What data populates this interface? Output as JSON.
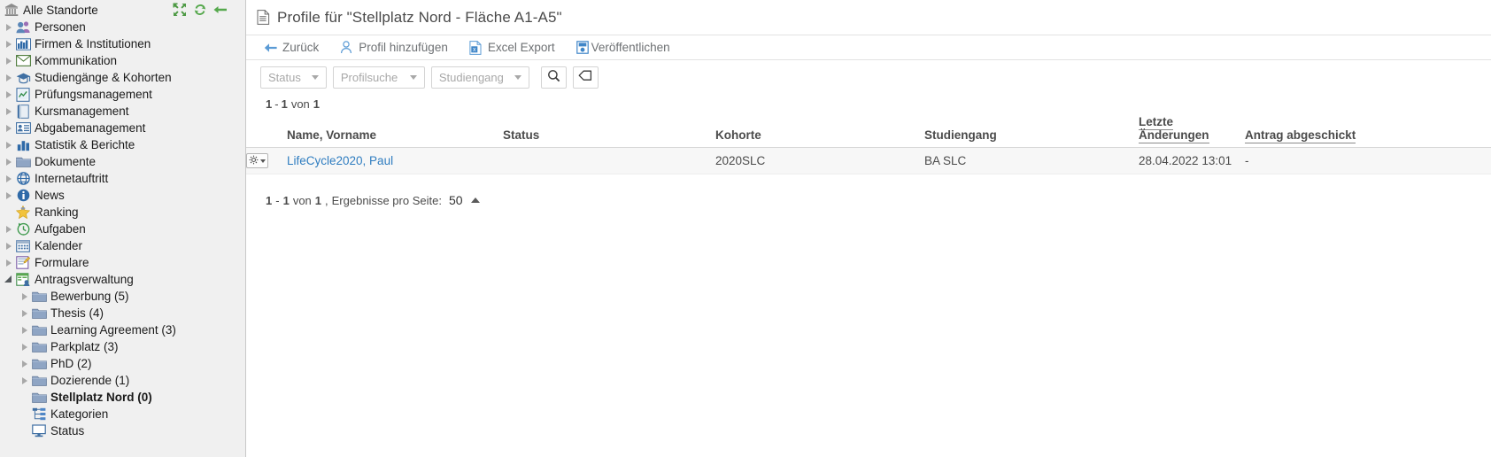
{
  "sidebar": {
    "root": {
      "label": "Alle Standorte",
      "icon": "bank-icon"
    },
    "tools": [
      {
        "name": "collapse-all-icon",
        "title": "collapse-all"
      },
      {
        "name": "refresh-icon",
        "title": "refresh"
      },
      {
        "name": "back-arrow-icon",
        "title": "back"
      }
    ],
    "items": [
      {
        "label": "Personen",
        "icon": "people-icon",
        "arrow": "closed",
        "indent": 1,
        "bold": false
      },
      {
        "label": "Firmen & Institutionen",
        "icon": "company-icon",
        "arrow": "closed",
        "indent": 1,
        "bold": false
      },
      {
        "label": "Kommunikation",
        "icon": "envelope-icon",
        "arrow": "closed",
        "indent": 1,
        "bold": false
      },
      {
        "label": "Studiengänge & Kohorten",
        "icon": "graduation-cap-icon",
        "arrow": "closed",
        "indent": 1,
        "bold": false
      },
      {
        "label": "Prüfungsmanagement",
        "icon": "exam-icon",
        "arrow": "closed",
        "indent": 1,
        "bold": false
      },
      {
        "label": "Kursmanagement",
        "icon": "book-icon",
        "arrow": "closed",
        "indent": 1,
        "bold": false
      },
      {
        "label": "Abgabemanagement",
        "icon": "idcard-icon",
        "arrow": "closed",
        "indent": 1,
        "bold": false
      },
      {
        "label": "Statistik & Berichte",
        "icon": "bar-chart-icon",
        "arrow": "closed",
        "indent": 1,
        "bold": false
      },
      {
        "label": "Dokumente",
        "icon": "folder-icon",
        "arrow": "closed",
        "indent": 1,
        "bold": false
      },
      {
        "label": "Internetauftritt",
        "icon": "globe-icon",
        "arrow": "closed",
        "indent": 1,
        "bold": false
      },
      {
        "label": "News",
        "icon": "info-icon",
        "arrow": "closed",
        "indent": 1,
        "bold": false
      },
      {
        "label": "Ranking",
        "icon": "star-icon",
        "arrow": "none",
        "indent": 1,
        "bold": false
      },
      {
        "label": "Aufgaben",
        "icon": "clock-icon",
        "arrow": "closed",
        "indent": 1,
        "bold": false
      },
      {
        "label": "Kalender",
        "icon": "calendar-icon",
        "arrow": "closed",
        "indent": 1,
        "bold": false
      },
      {
        "label": "Formulare",
        "icon": "forms-icon",
        "arrow": "closed",
        "indent": 1,
        "bold": false
      },
      {
        "label": "Antragsverwaltung",
        "icon": "application-mgmt-icon",
        "arrow": "open",
        "indent": 1,
        "bold": false
      },
      {
        "label": "Bewerbung (5)",
        "icon": "folder-icon",
        "arrow": "closed",
        "indent": 2,
        "bold": false
      },
      {
        "label": "Thesis (4)",
        "icon": "folder-icon",
        "arrow": "closed",
        "indent": 2,
        "bold": false
      },
      {
        "label": "Learning Agreement (3)",
        "icon": "folder-icon",
        "arrow": "closed",
        "indent": 2,
        "bold": false
      },
      {
        "label": "Parkplatz (3)",
        "icon": "folder-icon",
        "arrow": "closed",
        "indent": 2,
        "bold": false
      },
      {
        "label": "PhD (2)",
        "icon": "folder-icon",
        "arrow": "closed",
        "indent": 2,
        "bold": false
      },
      {
        "label": "Dozierende (1)",
        "icon": "folder-icon",
        "arrow": "closed",
        "indent": 2,
        "bold": false
      },
      {
        "label": "Stellplatz Nord (0)",
        "icon": "folder-icon",
        "arrow": "none",
        "indent": 2,
        "bold": true
      },
      {
        "label": "Kategorien",
        "icon": "categories-icon",
        "arrow": "none",
        "indent": 2,
        "bold": false
      },
      {
        "label": "Status",
        "icon": "status-monitor-icon",
        "arrow": "none",
        "indent": 2,
        "bold": false
      }
    ]
  },
  "main": {
    "title": "Profile für \"Stellplatz Nord - Fläche A1-A5\"",
    "title_icon": "document-icon",
    "actions": [
      {
        "label": "Zurück",
        "icon": "back-arrow-icon"
      },
      {
        "label": "Profil hinzufügen",
        "icon": "add-person-icon"
      },
      {
        "label": "Excel Export",
        "icon": "excel-icon"
      },
      {
        "label": "Veröffentlichen",
        "icon": "publish-icon"
      }
    ],
    "filters": [
      {
        "label": "Status",
        "name": "status-filter"
      },
      {
        "label": "Profilsuche",
        "name": "profilsuche-filter"
      },
      {
        "label": "Studiengang",
        "name": "studiengang-filter"
      }
    ],
    "search_button_icon": "search-icon",
    "clear_button_icon": "eraser-icon",
    "count_top": {
      "from": "1",
      "dash": "-",
      "to": "1",
      "von": "von",
      "total": "1"
    },
    "count_bottom": {
      "from": "1",
      "dash": "-",
      "to": "1",
      "von": "von",
      "total": "1",
      "separator": ",",
      "per_page_label": "Ergebnisse pro Seite:",
      "per_page_value": "50"
    },
    "table": {
      "columns": [
        {
          "label": "",
          "name": "col-menu",
          "sortable": false
        },
        {
          "label": "Name, Vorname",
          "name": "col-name",
          "sortable": false
        },
        {
          "label": "Status",
          "name": "col-status",
          "sortable": false
        },
        {
          "label": "Kohorte",
          "name": "col-kohorte",
          "sortable": false
        },
        {
          "label": "Studiengang",
          "name": "col-studiengang",
          "sortable": false
        },
        {
          "label": "Letzte Änderungen",
          "name": "col-letzte-aenderungen",
          "sortable": true
        },
        {
          "label": "Antrag abgeschickt",
          "name": "col-antrag-abgeschickt",
          "sortable": true
        }
      ],
      "rows": [
        {
          "name": "LifeCycle2020, Paul",
          "status": "",
          "kohorte": "2020SLC",
          "studiengang": "BA SLC",
          "letzte_aenderungen": "28.04.2022 13:01",
          "antrag_abgeschickt": "-"
        }
      ]
    }
  },
  "colors": {
    "link": "#2f7dc0",
    "sidebar_bg": "#f0f0f0",
    "row_bg": "#f7f7f7",
    "muted_text": "#6d7073",
    "green_icon": "#5aa84f"
  }
}
